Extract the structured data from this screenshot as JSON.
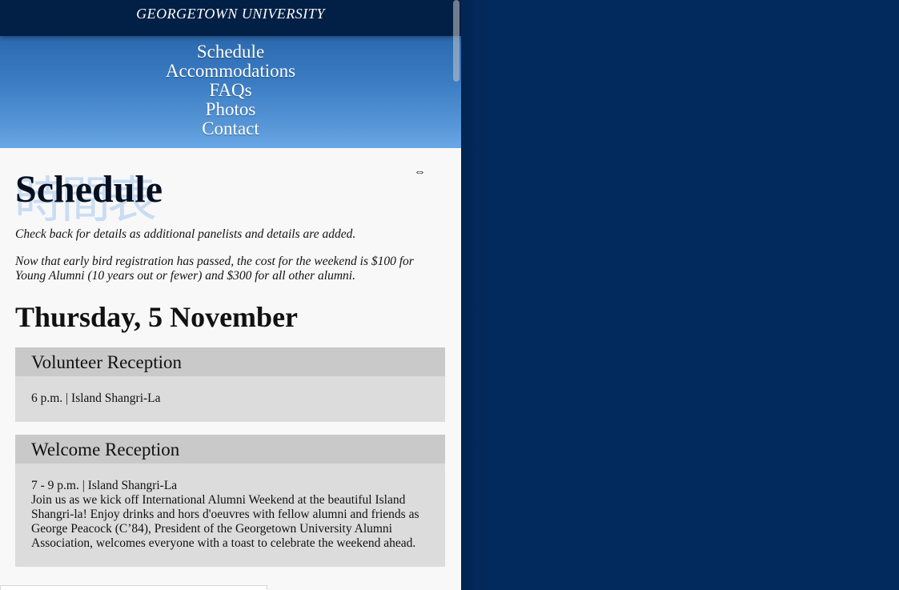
{
  "header": {
    "brand": "GEORGETOWN UNIVERSITY"
  },
  "nav": {
    "items": [
      {
        "label": "Schedule"
      },
      {
        "label": "Accommodations"
      },
      {
        "label": "FAQs"
      },
      {
        "label": "Photos"
      },
      {
        "label": "Contact"
      }
    ]
  },
  "main": {
    "kanji": "時間表",
    "title": "Schedule",
    "intro": [
      "Check back for details as additional panelists and details are added.",
      "Now that early bird registration has passed, the cost for the weekend is $100 for Young Alumni (10 years out or fewer) and $300 for all other alumni."
    ],
    "day_heading": "Thursday, 5 November",
    "events": [
      {
        "title": "Volunteer Reception",
        "time_place": "6 p.m. | Island Shangri-La",
        "description": ""
      },
      {
        "title": "Welcome Reception",
        "time_place": "7 - 9 p.m. | Island Shangri-La",
        "description": "Join us as we kick off International Alumni Weekend at the beautiful Island Shangri-la! Enjoy drinks and hors d'oeuvres with fellow alumni and friends as George Peacock (C’84), President of the Georgetown University Alumni Association, welcomes everyone with a toast to celebrate the weekend ahead."
      }
    ]
  },
  "cursor": {
    "glyph": "⇔"
  },
  "colors": {
    "topbar": "#021f45",
    "nav_gradient_top": "#2c6aaf",
    "nav_gradient_bottom": "#6aa8e6",
    "background": "#032a5c",
    "event_header": "#c9c9c9",
    "event_body": "#dcdcdc"
  }
}
